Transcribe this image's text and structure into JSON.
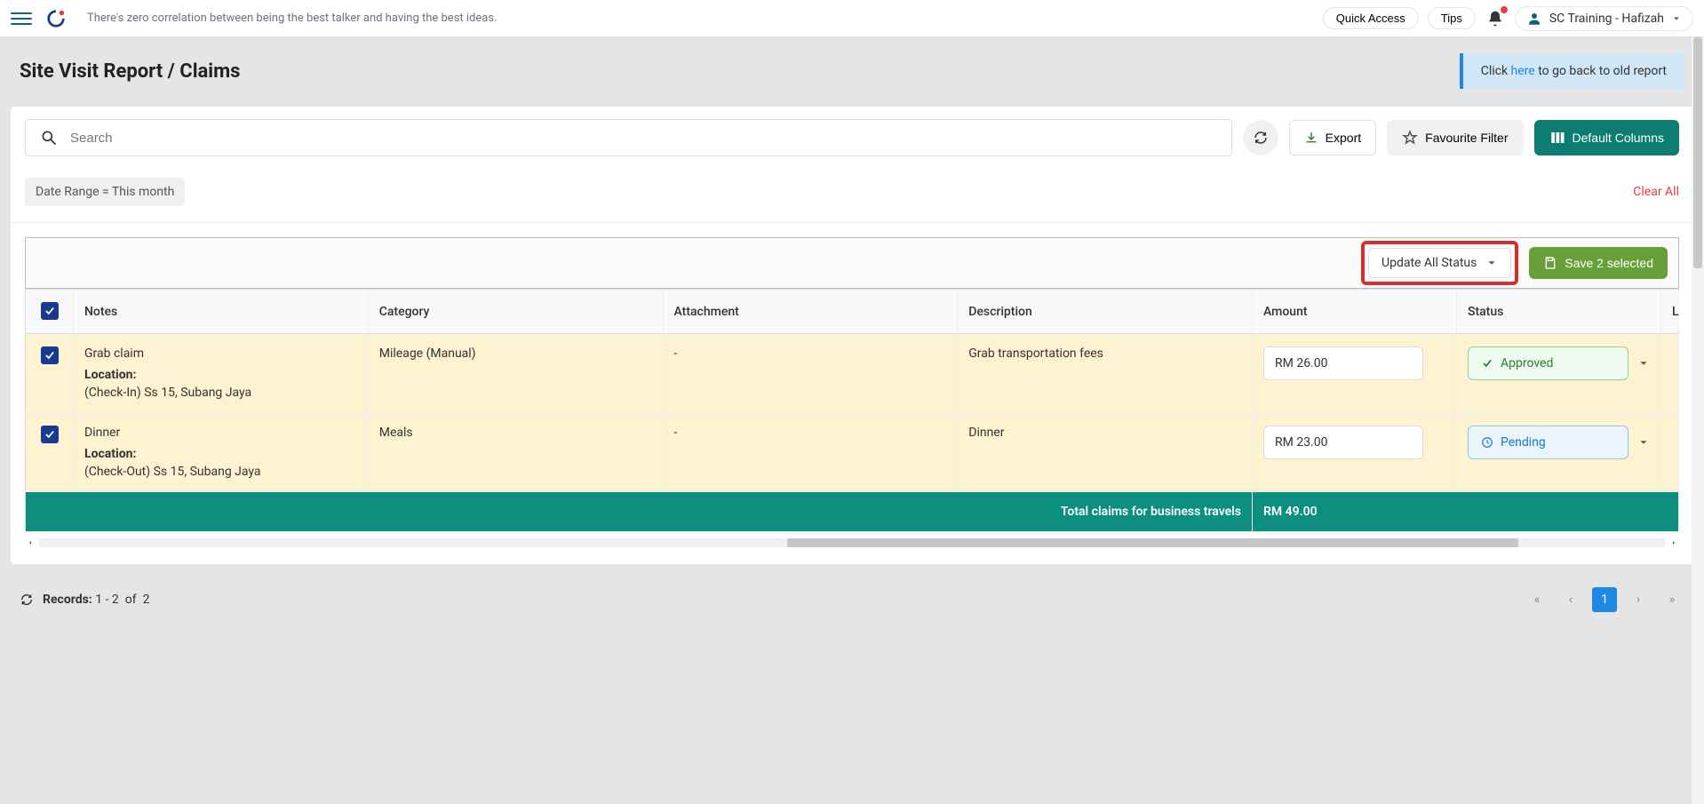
{
  "topbar": {
    "tagline": "There's zero correlation between being the best talker and having the best ideas.",
    "quick_access": "Quick Access",
    "tips": "Tips",
    "user_label": "SC Training - Hafizah"
  },
  "page": {
    "title": "Site Visit Report / Claims",
    "banner_prefix": "Click ",
    "banner_link": "here",
    "banner_suffix": " to go back to old report"
  },
  "toolbar": {
    "search_placeholder": "Search",
    "export": "Export",
    "favourite": "Favourite Filter",
    "default_cols": "Default Columns"
  },
  "filters": {
    "chip": "Date Range  =  This month",
    "clear": "Clear All"
  },
  "actions": {
    "update_all": "Update All Status",
    "save": "Save 2 selected"
  },
  "table": {
    "headers": {
      "notes": "Notes",
      "category": "Category",
      "attachment": "Attachment",
      "description": "Description",
      "amount": "Amount",
      "status": "Status",
      "last": "L"
    },
    "rows": [
      {
        "notes_title": "Grab claim",
        "loc_label": "Location:",
        "loc_value": "(Check-In) Ss 15, Subang Jaya",
        "category": "Mileage (Manual)",
        "attachment": "-",
        "description": "Grab transportation fees",
        "amount": "RM 26.00",
        "status_label": "Approved",
        "status_type": "approved"
      },
      {
        "notes_title": "Dinner",
        "loc_label": "Location:",
        "loc_value": "(Check-Out) Ss 15, Subang Jaya",
        "category": "Meals",
        "attachment": "-",
        "description": "Dinner",
        "amount": "RM 23.00",
        "status_label": "Pending",
        "status_type": "pending"
      }
    ],
    "total_label": "Total claims for business travels",
    "total_value": "RM 49.00"
  },
  "footer": {
    "records_label": "Records:",
    "records_range": "1 - 2",
    "of": "of",
    "records_total": "2",
    "page_current": "1"
  }
}
